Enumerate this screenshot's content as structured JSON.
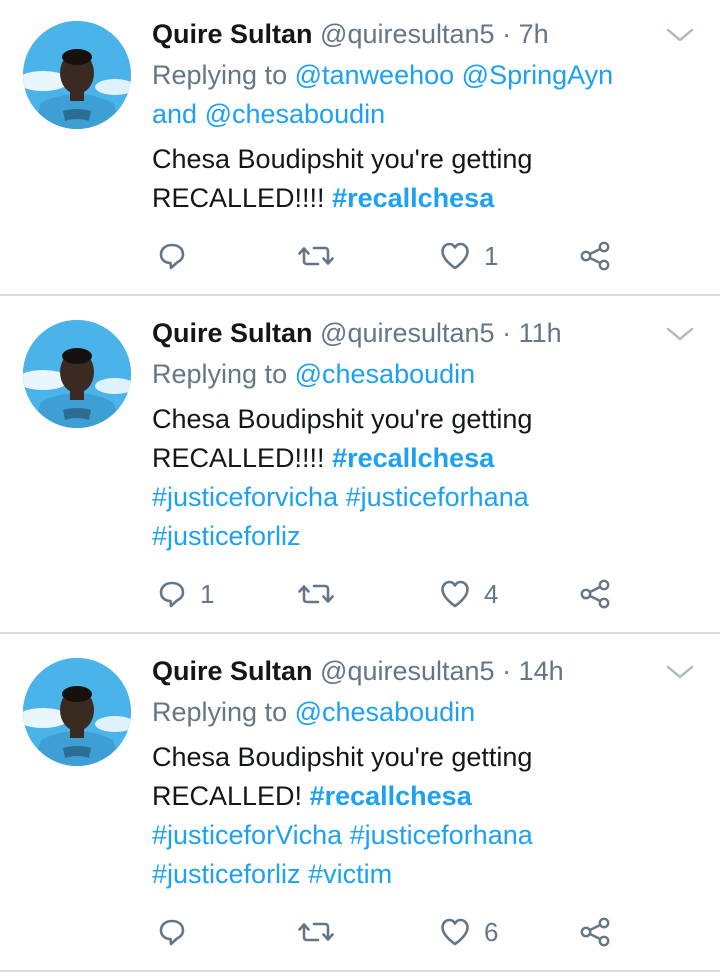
{
  "tweets": [
    {
      "name": "Quire Sultan",
      "handle": "@quiresultan5",
      "time": "· 7h",
      "replying_prefix": "Replying to",
      "replying_line1_mentions": [
        "@tanweehoo",
        "@SpringAyn"
      ],
      "replying_and": "and",
      "replying_line2_mention": "@chesaboudin",
      "line1": "Chesa Boudipshit you're getting",
      "line2_text": "RECALLED!!!!",
      "line2_hashtag": "#recallchesa",
      "reply_count": "",
      "like_count": "1"
    },
    {
      "name": "Quire Sultan",
      "handle": "@quiresultan5",
      "time": "· 11h",
      "replying_prefix": "Replying to",
      "replying_mention": "@chesaboudin",
      "line1": "Chesa Boudipshit you're getting",
      "line2_text": "RECALLED!!!!",
      "line2_hashtag": "#recallchesa",
      "line3_hashtags": [
        "#justiceforvicha",
        "#justiceforhana"
      ],
      "line4_hashtags": [
        "#justiceforliz"
      ],
      "reply_count": "1",
      "like_count": "4"
    },
    {
      "name": "Quire Sultan",
      "handle": "@quiresultan5",
      "time": "· 14h",
      "replying_prefix": "Replying to",
      "replying_mention": "@chesaboudin",
      "line1": "Chesa Boudipshit you're getting",
      "line2_text": "RECALLED!",
      "line2_hashtag": "#recallchesa",
      "line3_hashtags": [
        "#justiceforVicha",
        "#justiceforhana"
      ],
      "line4_hashtags": [
        "#justiceforliz",
        "#victim"
      ],
      "reply_count": "",
      "like_count": "6"
    }
  ],
  "colors": {
    "accent": "#1da1f2",
    "secondary_text": "#657786",
    "primary_text": "#14171a",
    "divider": "#d9dde1"
  },
  "icons": [
    "reply-icon",
    "retweet-icon",
    "like-icon",
    "share-icon",
    "chevron-down-icon"
  ]
}
